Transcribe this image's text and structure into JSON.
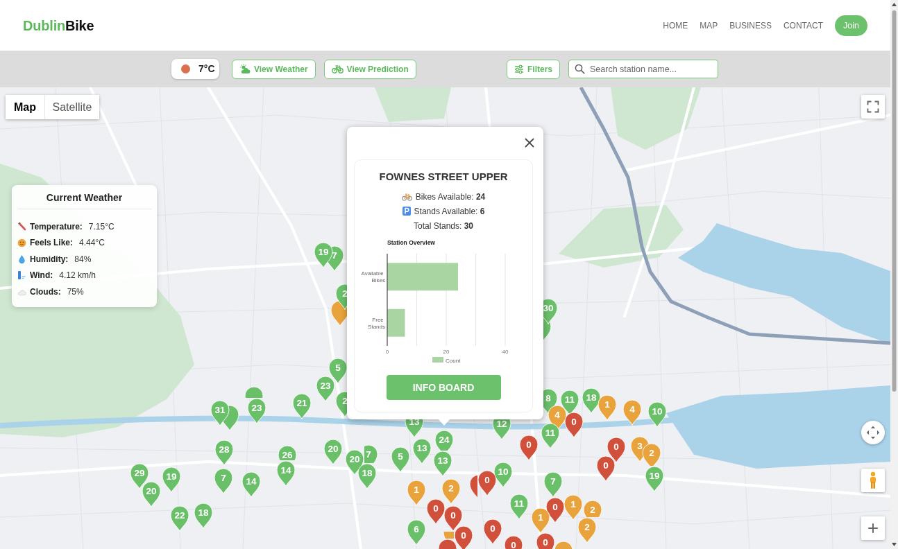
{
  "header": {
    "brand": {
      "lead": "Dublin",
      "rest": "Bike"
    },
    "nav": [
      "HOME",
      "MAP",
      "BUSINESS",
      "CONTACT"
    ],
    "join_button": "Join"
  },
  "toolbar": {
    "temperature": "7°C",
    "buttons": [
      {
        "label": "View Weather",
        "kind": "weather"
      },
      {
        "label": "View Prediction",
        "kind": "prediction"
      }
    ],
    "filters_button": "Filters",
    "search": {
      "placeholder": "Search station name..."
    }
  },
  "map": {
    "map_types": [
      {
        "label": "Map",
        "selected": true
      },
      {
        "label": "Satellite",
        "selected": false
      }
    ],
    "stations": [
      {
        "count": "19",
        "color": "#6abf69"
      },
      {
        "count": "7",
        "color": "#6abf69"
      },
      {
        "count": "2",
        "color": "#6abf69"
      },
      {
        "color": "#e8a33c"
      },
      {
        "count": "30",
        "color": "#6abf69"
      },
      {
        "color": "#6abf69"
      },
      {
        "count": "5",
        "color": "#6abf69"
      },
      {
        "color": "#6abf69"
      },
      {
        "count": "23",
        "color": "#6abf69"
      },
      {
        "count": "8",
        "color": "#6abf69"
      },
      {
        "count": "18",
        "color": "#6abf69"
      },
      {
        "count": "31",
        "color": "#6abf69"
      },
      {
        "count": "23",
        "color": "#6abf69"
      },
      {
        "count": "21",
        "color": "#6abf69"
      },
      {
        "count": "2",
        "color": "#6abf69"
      },
      {
        "count": "11",
        "color": "#6abf69"
      },
      {
        "count": "1",
        "color": "#e8a33c"
      },
      {
        "count": "4",
        "color": "#e8a33c"
      },
      {
        "count": "10",
        "color": "#6abf69"
      },
      {
        "color": "#6abf69"
      },
      {
        "count": "13",
        "color": "#6abf69"
      },
      {
        "count": "12",
        "color": "#6abf69"
      },
      {
        "count": "4",
        "color": "#e8a33c"
      },
      {
        "count": "0",
        "color": "#d0503c"
      },
      {
        "count": "24",
        "color": "#6abf69"
      },
      {
        "count": "0",
        "color": "#d0503c"
      },
      {
        "count": "11",
        "color": "#6abf69"
      },
      {
        "count": "28",
        "color": "#6abf69"
      },
      {
        "count": "26",
        "color": "#6abf69"
      },
      {
        "count": "20",
        "color": "#6abf69"
      },
      {
        "count": "7",
        "color": "#6abf69"
      },
      {
        "count": "5",
        "color": "#6abf69"
      },
      {
        "count": "13",
        "color": "#6abf69"
      },
      {
        "count": "0",
        "color": "#d0503c"
      },
      {
        "count": "3",
        "color": "#e8a33c"
      },
      {
        "count": "2",
        "color": "#e8a33c"
      },
      {
        "count": "14",
        "color": "#6abf69"
      },
      {
        "count": "20",
        "color": "#6abf69"
      },
      {
        "count": "13",
        "color": "#6abf69"
      },
      {
        "count": "10",
        "color": "#6abf69"
      },
      {
        "count": "0",
        "color": "#d0503c"
      },
      {
        "count": "29",
        "color": "#6abf69"
      },
      {
        "count": "19",
        "color": "#6abf69"
      },
      {
        "count": "7",
        "color": "#6abf69"
      },
      {
        "count": "14",
        "color": "#6abf69"
      },
      {
        "count": "18",
        "color": "#6abf69"
      },
      {
        "color": "#d0503c"
      },
      {
        "count": "0",
        "color": "#d0503c"
      },
      {
        "count": "7",
        "color": "#6abf69"
      },
      {
        "count": "19",
        "color": "#6abf69"
      },
      {
        "count": "20",
        "color": "#6abf69"
      },
      {
        "count": "1",
        "color": "#e8a33c"
      },
      {
        "count": "2",
        "color": "#e8a33c"
      },
      {
        "count": "22",
        "color": "#6abf69"
      },
      {
        "count": "18",
        "color": "#6abf69"
      },
      {
        "count": "0",
        "color": "#d0503c"
      },
      {
        "count": "0",
        "color": "#d0503c"
      },
      {
        "count": "11",
        "color": "#6abf69"
      },
      {
        "count": "0",
        "color": "#d0503c"
      },
      {
        "count": "1",
        "color": "#e8a33c"
      },
      {
        "count": "2",
        "color": "#e8a33c"
      },
      {
        "count": "6",
        "color": "#6abf69"
      },
      {
        "count": "0",
        "color": "#d0503c"
      },
      {
        "count": "1",
        "color": "#e8a33c"
      },
      {
        "count": "2",
        "color": "#e8a33c"
      },
      {
        "color": "#e8a33c"
      },
      {
        "count": "0",
        "color": "#d0503c"
      },
      {
        "count": "0",
        "color": "#d0503c"
      },
      {
        "count": "0",
        "color": "#d0503c"
      },
      {
        "color": "#d0503c"
      },
      {
        "color": "#e8a33c"
      }
    ]
  },
  "weather_panel": {
    "title": "Current Weather",
    "rows": [
      {
        "kind": "temperature",
        "label": "Temperature:",
        "value": "7.15°C"
      },
      {
        "kind": "feels_like",
        "label": "Feels Like:",
        "value": "4.44°C"
      },
      {
        "kind": "humidity",
        "label": "Humidity:",
        "value": "84%"
      },
      {
        "kind": "wind",
        "label": "Wind:",
        "value": "4.12 km/h"
      },
      {
        "kind": "clouds",
        "label": "Clouds:",
        "value": "75%"
      }
    ]
  },
  "station_popup": {
    "title": "FOWNES STREET UPPER",
    "lines": [
      {
        "kind": "bikes",
        "text": "Bikes Available: **24**"
      },
      {
        "kind": "stands",
        "text": "Stands Available: **6**"
      },
      {
        "kind": "total",
        "text": "Total Stands: **30**"
      }
    ],
    "chart_data": {
      "type": "bar",
      "orientation": "horizontal",
      "title": "Station Overview",
      "categories": [
        "Available Bikes",
        "Free Stands"
      ],
      "series": [
        {
          "name": "Count",
          "color": "#a8d5a2",
          "values": [
            24,
            6
          ]
        }
      ],
      "xlim": [
        0,
        40
      ],
      "xticks": [
        0,
        20,
        40
      ]
    },
    "button": "INFO BOARD"
  }
}
